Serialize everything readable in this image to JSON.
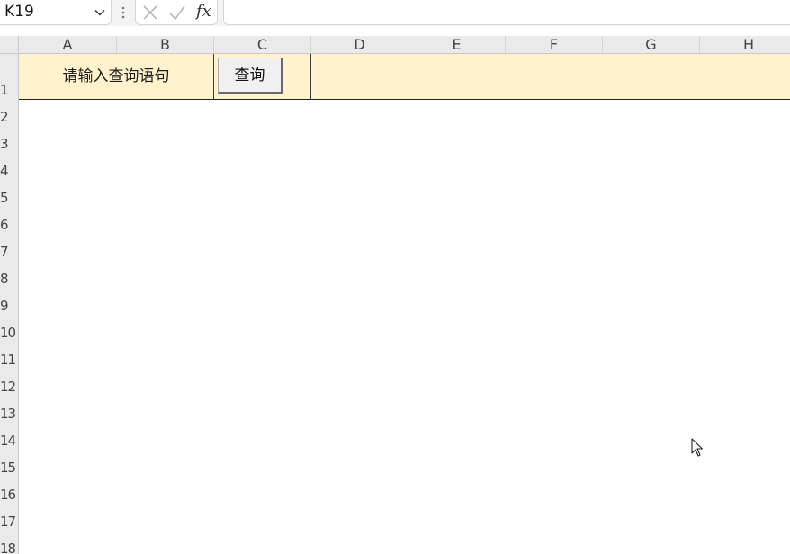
{
  "formula_bar": {
    "name_box_value": "K19",
    "fx_label": "fx",
    "formula_value": "",
    "icons": {
      "dropdown": "chevron-down-icon",
      "separator": "vertical-dots-icon",
      "cancel": "close-icon",
      "enter": "check-icon"
    }
  },
  "columns": [
    "A",
    "B",
    "C",
    "D",
    "E",
    "F",
    "G",
    "H"
  ],
  "rows": [
    "1",
    "2",
    "3",
    "4",
    "5",
    "6",
    "7",
    "8",
    "9",
    "10",
    "11",
    "12",
    "13",
    "14",
    "15",
    "16",
    "17",
    "18"
  ],
  "sheet": {
    "prompt_label": "请输入查询语句",
    "query_button_label": "查询",
    "row1_fill_color": "#fff2cc"
  },
  "selected_cell": "K19"
}
